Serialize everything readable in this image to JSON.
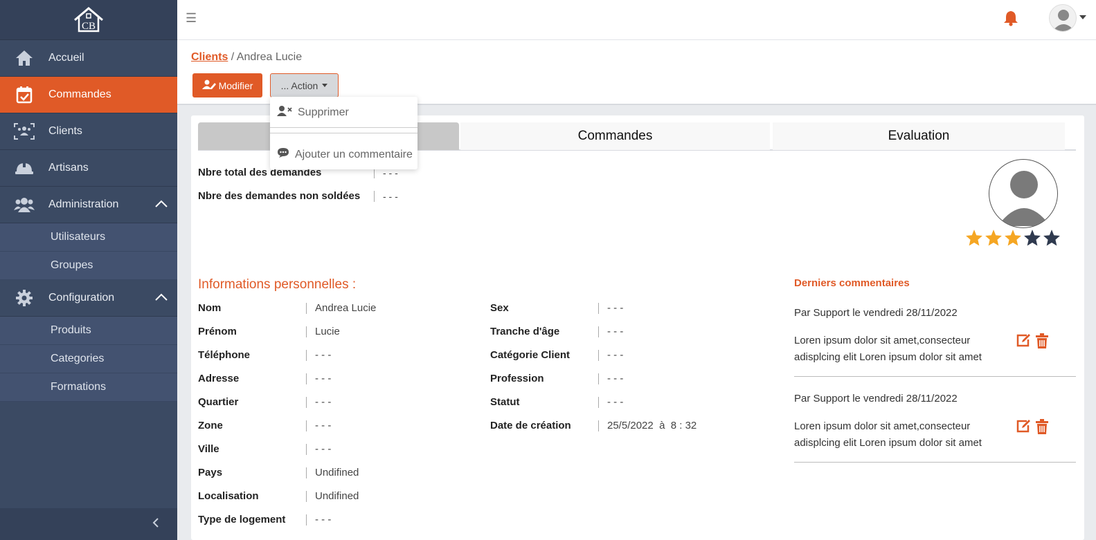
{
  "brand": {
    "logo_text": "CB"
  },
  "sidebar": {
    "items": [
      {
        "label": "Accueil",
        "icon": "home-icon"
      },
      {
        "label": "Commandes",
        "icon": "calendar-check-icon",
        "active": true
      },
      {
        "label": "Clients",
        "icon": "users-scan-icon"
      },
      {
        "label": "Artisans",
        "icon": "hard-hat-icon"
      },
      {
        "label": "Administration",
        "icon": "users-group-icon",
        "expanded": true,
        "children": [
          "Utilisateurs",
          "Groupes"
        ]
      },
      {
        "label": "Configuration",
        "icon": "gear-icon",
        "expanded": true,
        "children": [
          "Produits",
          "Categories",
          "Formations"
        ]
      }
    ]
  },
  "breadcrumb": {
    "parent": "Clients",
    "separator": " / ",
    "current": "Andrea Lucie"
  },
  "toolbar": {
    "modifier_label": "Modifier",
    "action_label": "... Action"
  },
  "dropdown": {
    "items": [
      "Supprimer",
      "Ajouter un commentaire"
    ]
  },
  "tabs": [
    "",
    "Commandes",
    "Evaluation"
  ],
  "stats": [
    {
      "label": "Nbre total des demandes",
      "value": "- - -"
    },
    {
      "label": "Nbre des demandes non soldées",
      "value": "- - -"
    }
  ],
  "rating": {
    "value": 3,
    "max": 5
  },
  "personal": {
    "title": "Informations personnelles :",
    "left": [
      {
        "label": "Nom",
        "value": "Andrea Lucie"
      },
      {
        "label": "Prénom",
        "value": "Lucie"
      },
      {
        "label": "Téléphone",
        "value": "- - -"
      },
      {
        "label": "Adresse",
        "value": "- - -"
      },
      {
        "label": "Quartier",
        "value": "- - -"
      },
      {
        "label": "Zone",
        "value": "- - -"
      },
      {
        "label": "Ville",
        "value": "- - -"
      },
      {
        "label": "Pays",
        "value": "Undifined"
      },
      {
        "label": "Localisation",
        "value": "Undifined"
      },
      {
        "label": "Type de logement",
        "value": "- - -"
      }
    ],
    "right": [
      {
        "label": "Sex",
        "value": "- - -"
      },
      {
        "label": "Tranche d'âge",
        "value": "- - -"
      },
      {
        "label": "Catégorie Client",
        "value": "- - -"
      },
      {
        "label": "Profession",
        "value": "- - -"
      },
      {
        "label": "Statut",
        "value": "- - -"
      },
      {
        "label": "Date de création",
        "value": "25/5/2022  à  8 : 32"
      }
    ]
  },
  "comments": {
    "title": "Derniers commentaires",
    "items": [
      {
        "header": "Par Support le vendredi 28/11/2022",
        "body": "Loren ipsum dolor sit amet,consecteur adisplcing elit Loren ipsum dolor sit amet"
      },
      {
        "header": "Par Support le vendredi 28/11/2022",
        "body": "Loren ipsum dolor sit amet,consecteur adisplcing elit Loren ipsum dolor sit amet"
      }
    ]
  },
  "colors": {
    "accent": "#e05a27",
    "sidebar": "#3b4a63",
    "star_on": "#f5a623",
    "star_off": "#2f3a4f"
  }
}
